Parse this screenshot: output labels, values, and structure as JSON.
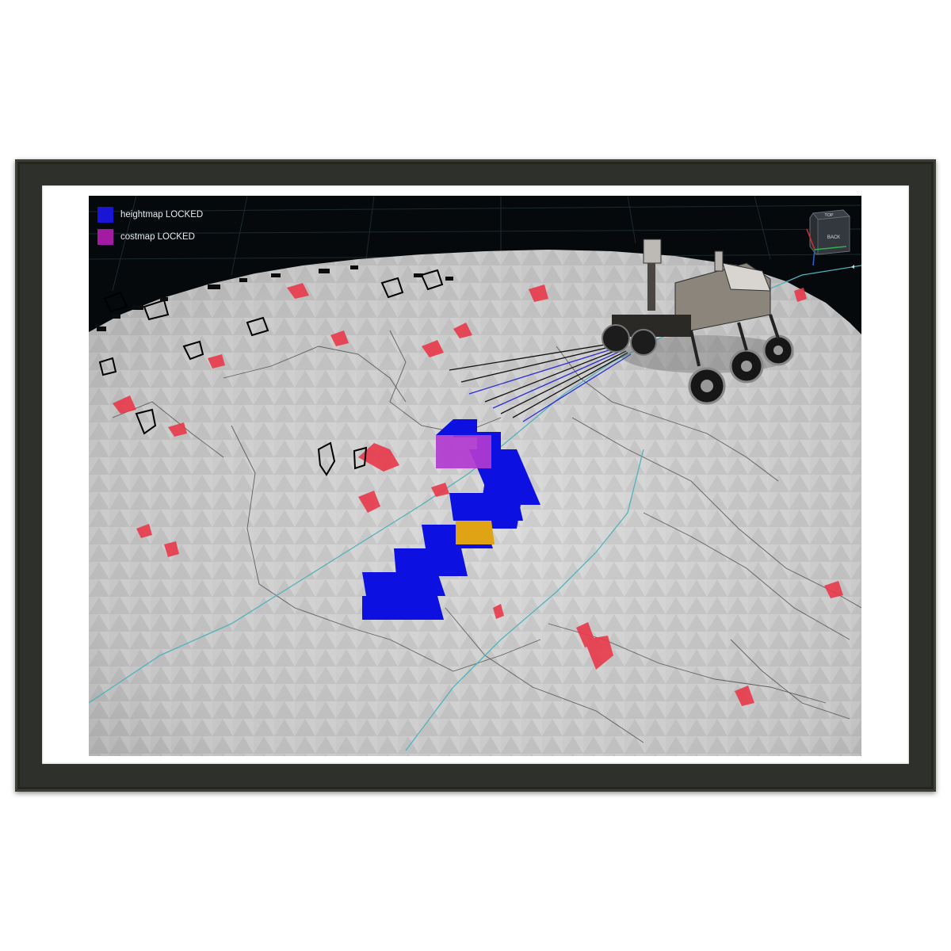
{
  "legend": {
    "items": [
      {
        "label": "heightmap LOCKED",
        "color": "#1a14d6"
      },
      {
        "label": "costmap LOCKED",
        "color": "#a31ba3"
      }
    ]
  },
  "view_cube": {
    "top_label": "TOP",
    "back_label": "BACK"
  },
  "colors": {
    "background": "#05090c",
    "terrain": "#c9c9c9",
    "hazard": "#e8394a",
    "path": "#0c10e0",
    "goal": "#e0a313",
    "trajectory": "#4fb3bd"
  },
  "scene": {
    "vehicle": "rover-icon",
    "map_overlay": "grid-path"
  }
}
